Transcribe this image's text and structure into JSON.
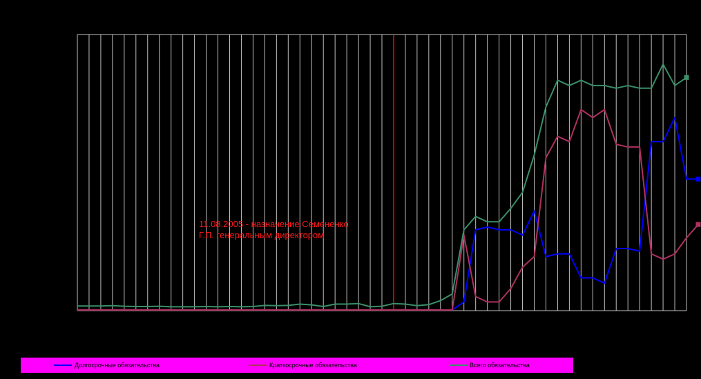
{
  "chart_data": {
    "type": "line",
    "title": "",
    "xlabel": "",
    "ylabel": "",
    "grid": "vertical",
    "legend_position": "bottom",
    "x_count": 53,
    "event_marker_index": 27,
    "annotation": "11.08.2005 - назначение Семененко\nГ.П. генеральным директором",
    "ylim": [
      0,
      100
    ],
    "series": [
      {
        "name": "Долгосрочные обязательства",
        "color": "#0000ff",
        "marker": "square",
        "values": [
          0,
          0,
          0,
          0,
          0,
          0,
          0,
          0,
          0,
          0,
          0,
          0,
          0,
          0,
          0,
          0,
          0,
          0,
          0,
          0,
          0,
          0,
          0,
          0,
          0,
          0,
          0,
          0,
          0,
          0,
          0,
          0,
          0,
          3,
          30,
          31,
          30,
          30,
          28,
          37,
          20,
          21,
          21,
          12,
          12,
          10,
          23,
          23,
          22,
          63,
          63,
          72,
          49,
          49
        ]
      },
      {
        "name": "Краткосрочные обязательства",
        "color": "#b03060",
        "marker": "square",
        "values": [
          0,
          0,
          0,
          0,
          0,
          0,
          0,
          0,
          0,
          0,
          0,
          0,
          0,
          0,
          0,
          0,
          0,
          0,
          0,
          0,
          0,
          0,
          0,
          0,
          0,
          0,
          0,
          0,
          0,
          0,
          0,
          0,
          0,
          28,
          5,
          3,
          3,
          8,
          16,
          20,
          57,
          65,
          63,
          75,
          72,
          75,
          62,
          61,
          61,
          21,
          19,
          21,
          27,
          32
        ]
      },
      {
        "name": "Всего обязательства",
        "color": "#3a8f6a",
        "marker": "square",
        "values": [
          1.5,
          1.5,
          1.5,
          1.6,
          1.4,
          1.3,
          1.3,
          1.4,
          1.2,
          1.2,
          1.2,
          1.3,
          1.2,
          1.3,
          1.2,
          1.3,
          1.7,
          1.6,
          1.7,
          2.2,
          1.9,
          1.3,
          2.2,
          2.2,
          2.4,
          1.2,
          1.4,
          2.4,
          2.2,
          1.6,
          2.0,
          3.5,
          6.0,
          30,
          35,
          33,
          33,
          38,
          44,
          58,
          76,
          86,
          84,
          86,
          84,
          84,
          83,
          84,
          83,
          83,
          92,
          84,
          87
        ]
      }
    ]
  },
  "legend": {
    "items": [
      {
        "label": "Долгосрочные обязательства",
        "color": "#0000ff"
      },
      {
        "label": "Краткосрочные обязательства",
        "color": "#b03060"
      },
      {
        "label": "Всего обязательства",
        "color": "#3a8f6a"
      }
    ]
  },
  "colors": {
    "background": "#000000",
    "grid": "#c0c0c0",
    "event_line": "#ff0000",
    "annotation": "#ff1a1a",
    "legend_background": "#ff00ff"
  }
}
